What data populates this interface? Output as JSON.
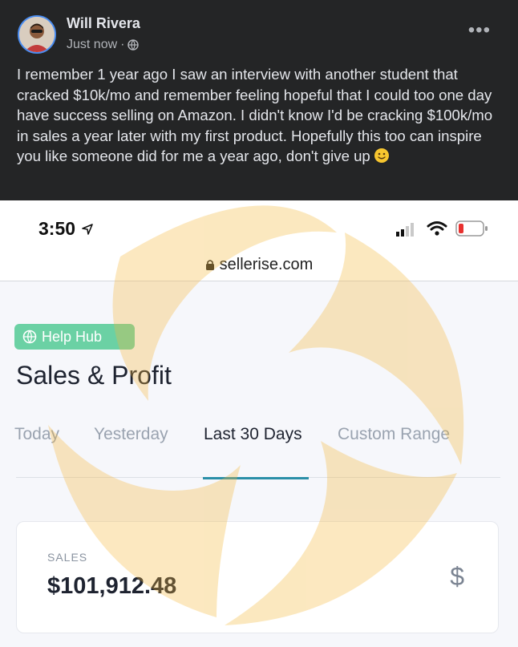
{
  "post": {
    "author": "Will Rivera",
    "timestamp": "Just now",
    "separator": "·",
    "audience_icon": "globe-icon",
    "more_icon": "more-options-icon",
    "more_label": "•••",
    "body": "I remember 1 year ago I saw an interview with another student that cracked $10k/mo and remember feeling hopeful that I could too one day have success selling on Amazon. I didn't know I'd be cracking $100k/mo in sales a year later with my first product. Hopefully this too can inspire you like someone did for me a year ago, don't give up",
    "emoji": "slightly-smiling-face-icon"
  },
  "screenshot": {
    "status": {
      "time": "3:50",
      "location_icon": "location-arrow-icon",
      "signal_icon": "cellular-signal-icon",
      "wifi_icon": "wifi-icon",
      "battery_icon": "battery-low-icon"
    },
    "url": {
      "lock_icon": "lock-icon",
      "domain": "sellerise.com"
    },
    "help_hub": "Help Hub",
    "page_title": "Sales & Profit",
    "tabs": [
      {
        "label": "Today",
        "active": false
      },
      {
        "label": "Yesterday",
        "active": false
      },
      {
        "label": "Last 30 Days",
        "active": true
      },
      {
        "label": "Custom Range",
        "active": false
      }
    ],
    "sales_card": {
      "label": "SALES",
      "value": "$101,912.48",
      "icon_label": "$"
    }
  },
  "colors": {
    "post_bg": "#242526",
    "post_text": "#e4e6eb",
    "help_hub": "#6bd1a4",
    "tab_active_underline": "#2a8fa8",
    "watermark": "#f7c55a"
  }
}
